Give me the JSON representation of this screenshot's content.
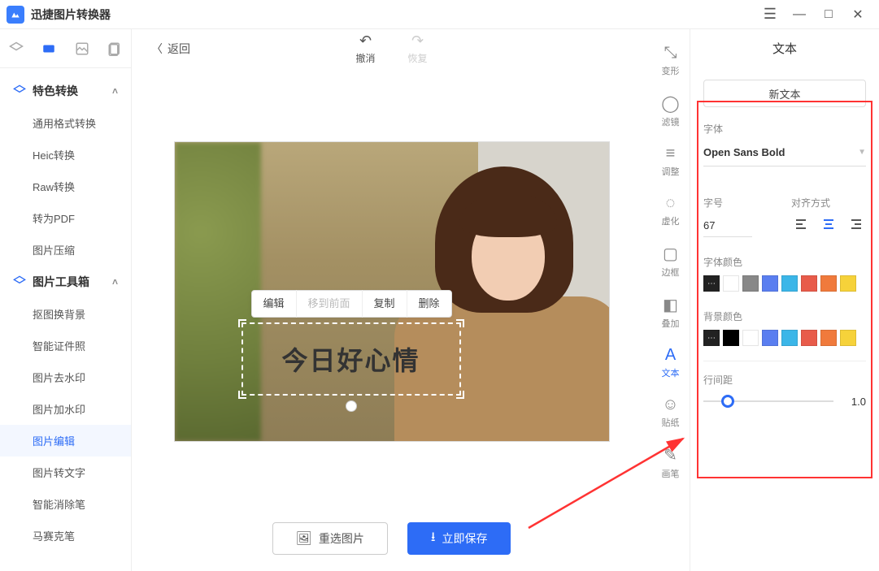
{
  "app": {
    "title": "迅捷图片转换器"
  },
  "window": {
    "menu": "☰",
    "min": "—",
    "max": "□",
    "close": "✕"
  },
  "sidebar": {
    "sections": [
      {
        "label": "特色转换",
        "items": [
          "通用格式转换",
          "Heic转换",
          "Raw转换",
          "转为PDF",
          "图片压缩"
        ]
      },
      {
        "label": "图片工具箱",
        "items": [
          "抠图换背景",
          "智能证件照",
          "图片去水印",
          "图片加水印",
          "图片编辑",
          "图片转文字",
          "智能消除笔",
          "马赛克笔"
        ]
      }
    ],
    "active": "图片编辑"
  },
  "editor": {
    "back": "返回",
    "undo": "撤消",
    "redo": "恢复",
    "floatToolbar": {
      "edit": "编辑",
      "moveFront": "移到前面",
      "copy": "复制",
      "delete": "删除"
    },
    "textContent": "今日好心情",
    "reselect": "重选图片",
    "save": "立即保存"
  },
  "toolStrip": [
    {
      "label": "变形",
      "icon": "⤡"
    },
    {
      "label": "滤镜",
      "icon": "◯"
    },
    {
      "label": "调整",
      "icon": "≡"
    },
    {
      "label": "虚化",
      "icon": "◌"
    },
    {
      "label": "边框",
      "icon": "▢"
    },
    {
      "label": "叠加",
      "icon": "◧"
    },
    {
      "label": "文本",
      "icon": "A",
      "active": true
    },
    {
      "label": "贴纸",
      "icon": "☺"
    },
    {
      "label": "画笔",
      "icon": "✎"
    }
  ],
  "props": {
    "title": "文本",
    "newText": "新文本",
    "fontLabel": "字体",
    "fontName": "Open Sans Bold",
    "sizeLabel": "字号",
    "sizeValue": "67",
    "alignLabel": "对齐方式",
    "fontColorLabel": "字体颜色",
    "fontColors": [
      "#ffffff",
      "#888888",
      "#5a7ef0",
      "#3bb6e8",
      "#e85b4a",
      "#f07a3c",
      "#f6d23a"
    ],
    "bgColorLabel": "背景颜色",
    "bgColors": [
      "#000000",
      "#ffffff",
      "#5a7ef0",
      "#3bb6e8",
      "#e85b4a",
      "#f07a3c",
      "#f6d23a"
    ],
    "lineHeightLabel": "行间距",
    "lineHeightValue": "1.0"
  }
}
